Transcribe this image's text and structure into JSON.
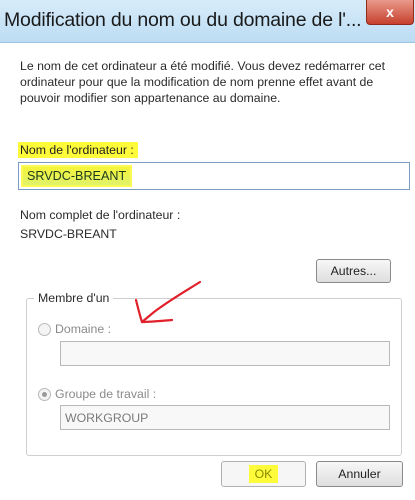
{
  "dialog": {
    "title": "Modification du nom ou du domaine de l'...",
    "close_label": "x"
  },
  "intro_text": "Le nom de cet ordinateur a été modifié. Vous devez redémarrer cet ordinateur pour que la modification de nom prenne effet avant de pouvoir modifier son appartenance au domaine.",
  "computer_name": {
    "label": "Nom de l'ordinateur :",
    "value": "SRVDC-BREANT"
  },
  "full_name": {
    "label": "Nom complet de l'ordinateur :",
    "value": "SRVDC-BREANT"
  },
  "more_button": "Autres...",
  "membership": {
    "legend": "Membre d'un",
    "domain": {
      "label": "Domaine :",
      "value": "",
      "selected": false
    },
    "workgroup": {
      "label": "Groupe de travail :",
      "value": "WORKGROUP",
      "selected": true
    }
  },
  "buttons": {
    "ok": "OK",
    "cancel": "Annuler"
  },
  "annotation": {
    "color": "#e0202a",
    "highlight_color": "#fdfb3a"
  }
}
